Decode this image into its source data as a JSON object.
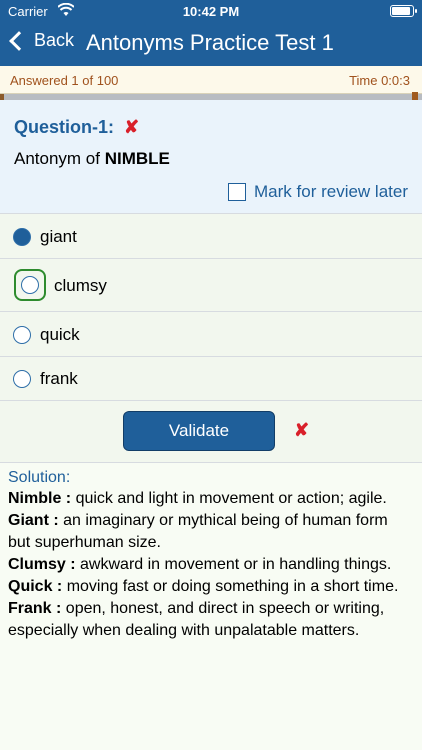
{
  "status_bar": {
    "carrier": "Carrier",
    "time": "10:42 PM"
  },
  "nav": {
    "back_label": "Back",
    "title": "Antonyms Practice Test 1"
  },
  "progress": {
    "answered_text": "Answered 1 of 100",
    "time_text": "Time 0:0:3",
    "fraction": 0.01
  },
  "question": {
    "number_label": "Question-1:",
    "prompt_prefix": "Antonym of",
    "prompt_word": "NIMBLE",
    "review_label": "Mark for review later"
  },
  "options": [
    {
      "label": "giant",
      "selected": true,
      "correct": false
    },
    {
      "label": "clumsy",
      "selected": false,
      "correct": true
    },
    {
      "label": "quick",
      "selected": false,
      "correct": false
    },
    {
      "label": "frank",
      "selected": false,
      "correct": false
    }
  ],
  "validate_label": "Validate",
  "solution": {
    "title": "Solution:",
    "items": [
      {
        "term": "Nimble :",
        "definition": "quick and light in movement or action; agile."
      },
      {
        "term": "Giant :",
        "definition": "an imaginary or mythical being of human form but superhuman size."
      },
      {
        "term": "Clumsy :",
        "definition": "awkward in movement or in handling things."
      },
      {
        "term": "Quick :",
        "definition": "moving fast or doing something in a short time."
      },
      {
        "term": "Frank :",
        "definition": "open, honest, and direct in speech or writing, especially when dealing with unpalatable matters."
      }
    ]
  },
  "colors": {
    "header": "#1f5f9a",
    "accent_brown": "#a0521d",
    "wrong": "#d9202a",
    "correct": "#2e8b2e"
  },
  "icons": {
    "wrong_mark": "✘",
    "back": "chevron-left-icon",
    "wifi": "wifi-icon",
    "battery": "battery-icon"
  }
}
